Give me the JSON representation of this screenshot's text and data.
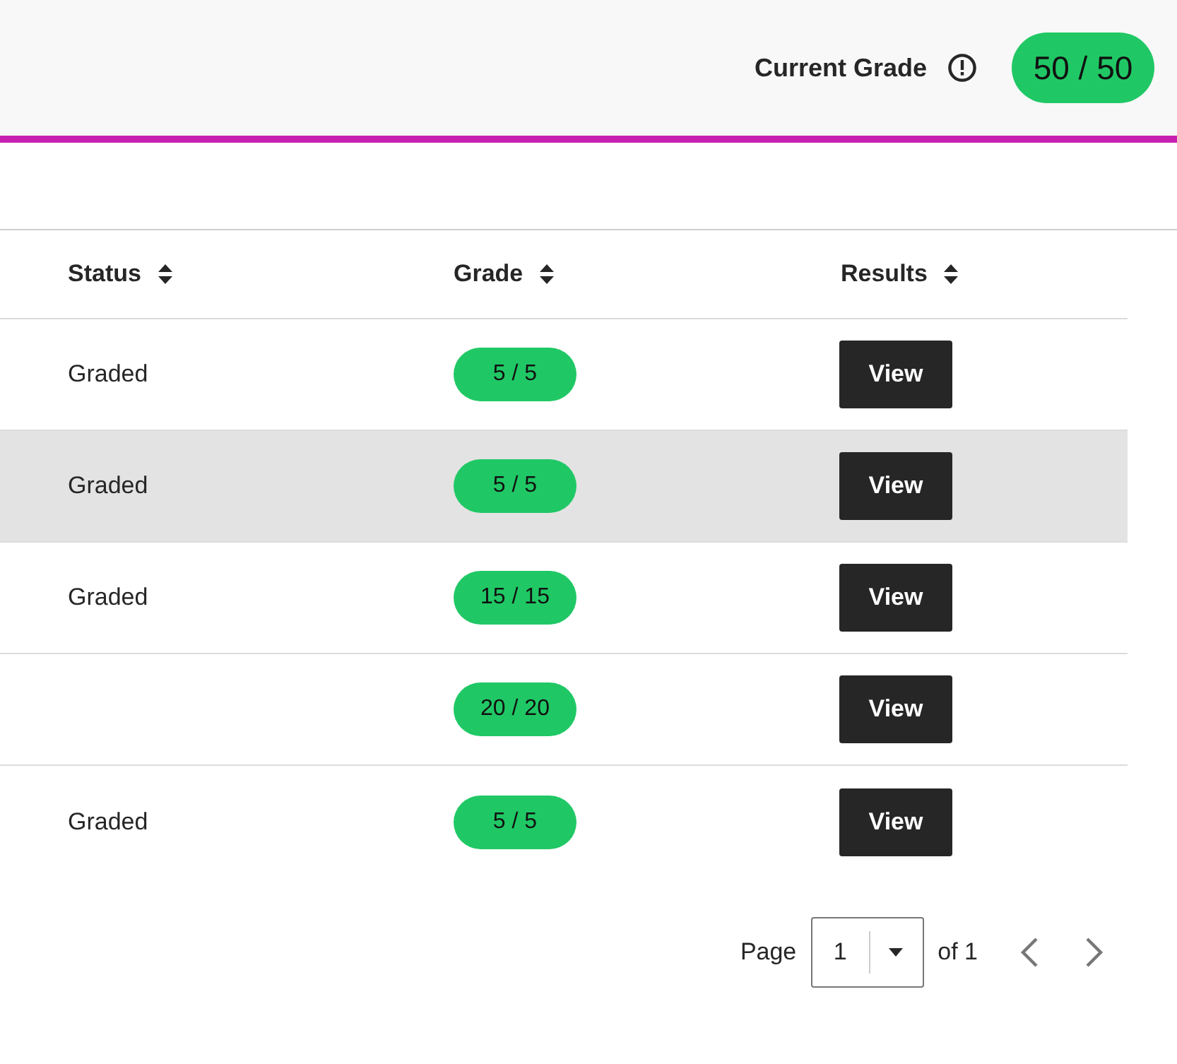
{
  "header": {
    "label": "Current Grade",
    "grade": "50 / 50"
  },
  "table": {
    "columns": [
      "Status",
      "Grade",
      "Results"
    ],
    "rows": [
      {
        "status": "Graded",
        "grade": "5 / 5",
        "action": "View",
        "highlighted": false
      },
      {
        "status": "Graded",
        "grade": "5 / 5",
        "action": "View",
        "highlighted": true
      },
      {
        "status": "Graded",
        "grade": "15 / 15",
        "action": "View",
        "highlighted": false
      },
      {
        "grade": "20 / 20",
        "action": "View",
        "highlighted": false
      },
      {
        "status": "Graded",
        "grade": "5 / 5",
        "action": "View",
        "highlighted": false
      }
    ]
  },
  "pagination": {
    "label": "Page",
    "page": "1",
    "total": "of 1"
  }
}
